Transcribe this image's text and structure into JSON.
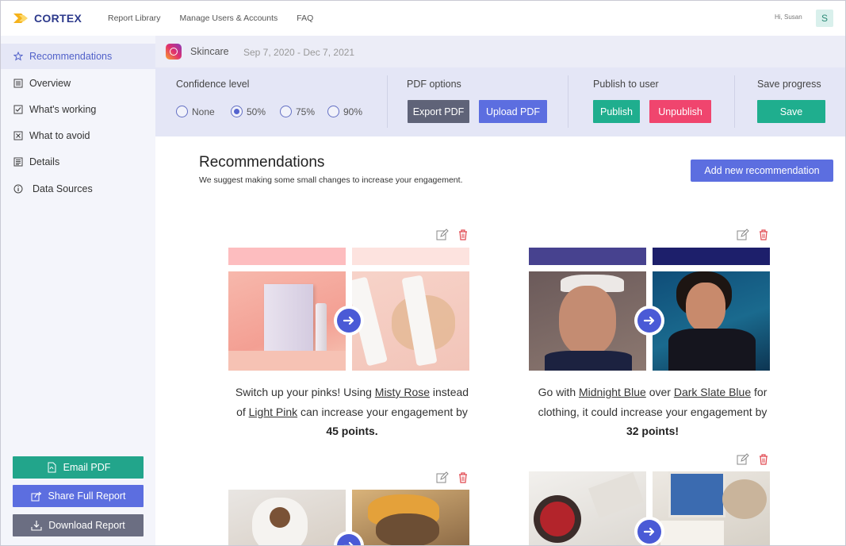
{
  "app": {
    "name": "CORTEX",
    "nav": [
      "Report Library",
      "Manage Users & Accounts",
      "FAQ"
    ],
    "greeting": "Hi, Susan",
    "avatar_initial": "S",
    "brand_color": "#2d3a8c",
    "logo_accent": "#f5b21b"
  },
  "sidebar": {
    "items": [
      {
        "label": "Recommendations",
        "icon": "star-icon",
        "active": true
      },
      {
        "label": "Overview",
        "icon": "list-icon",
        "active": false
      },
      {
        "label": "What's working",
        "icon": "check-square-icon",
        "active": false
      },
      {
        "label": "What to avoid",
        "icon": "x-square-icon",
        "active": false
      },
      {
        "label": "Details",
        "icon": "details-icon",
        "active": false
      },
      {
        "label": "Data Sources",
        "icon": "info-icon",
        "active": false
      }
    ],
    "actions": [
      {
        "label": "Email PDF",
        "icon": "pdf-icon",
        "color": "#22a58b"
      },
      {
        "label": "Share Full Report",
        "icon": "share-icon",
        "color": "#5c6ee0"
      },
      {
        "label": "Download Report",
        "icon": "download-icon",
        "color": "#6b6e82"
      }
    ]
  },
  "report": {
    "platform_icon": "instagram-icon",
    "brand": "Skincare",
    "date_range": "Sep 7, 2020 - Dec 7, 2021"
  },
  "controls": {
    "confidence": {
      "label": "Confidence level",
      "options": [
        "None",
        "50%",
        "75%",
        "90%"
      ],
      "selected": "50%"
    },
    "pdf": {
      "label": "PDF options",
      "export_label": "Export PDF",
      "upload_label": "Upload PDF"
    },
    "publish": {
      "label": "Publish to user",
      "publish_label": "Publish",
      "unpublish_label": "Unpublish"
    },
    "save": {
      "label": "Save progress",
      "save_label": "Save"
    },
    "colors": {
      "export": "#5f6378",
      "upload": "#5c6ee0",
      "publish": "#1fae8e",
      "unpublish": "#f0456e",
      "save": "#1fae8e"
    }
  },
  "main": {
    "title": "Recommendations",
    "subtitle": "We suggest making some small changes to increase your engagement.",
    "add_label": "Add new recommendation"
  },
  "recommendations": [
    {
      "swatch_from": "#fdbdbf",
      "swatch_to": "#fde3df",
      "line1_pre": "Switch up your pinks! Using ",
      "color_a": "Misty Rose",
      "line1_post": " instead",
      "line2_pre": "of ",
      "color_b": "Light Pink",
      "line2_post": " can increase your engagement by",
      "points": "45 points."
    },
    {
      "swatch_from": "#47428f",
      "swatch_to": "#1d1f6b",
      "line1_pre": "Go with ",
      "color_a": "Midnight Blue",
      "line1_mid": " over ",
      "color_b": "Dark Slate Blue",
      "line1_post": " for",
      "line2_pre": "clothing, it could increase your engagement by",
      "points": "32 points!"
    }
  ]
}
